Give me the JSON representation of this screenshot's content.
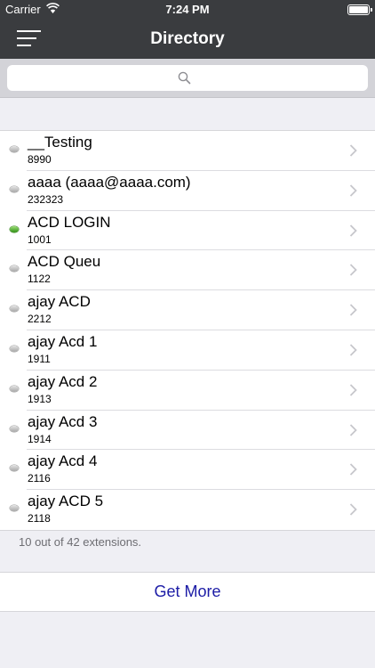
{
  "status_bar": {
    "carrier": "Carrier",
    "time": "7:24 PM"
  },
  "nav": {
    "title": "Directory",
    "menu_icon": "hamburger-icon"
  },
  "search": {
    "placeholder": "",
    "icon": "search-icon"
  },
  "contacts": [
    {
      "name": "__Testing",
      "ext": "8990",
      "status": "offline"
    },
    {
      "name": "aaaa (aaaa@aaaa.com)",
      "ext": "232323",
      "status": "offline"
    },
    {
      "name": "ACD LOGIN",
      "ext": "1001",
      "status": "online"
    },
    {
      "name": "ACD Queu",
      "ext": "1122",
      "status": "offline"
    },
    {
      "name": "ajay ACD",
      "ext": "2212",
      "status": "offline"
    },
    {
      "name": "ajay Acd 1",
      "ext": "1911",
      "status": "offline"
    },
    {
      "name": "ajay Acd 2",
      "ext": "1913",
      "status": "offline"
    },
    {
      "name": "ajay Acd 3",
      "ext": "1914",
      "status": "offline"
    },
    {
      "name": "ajay Acd 4",
      "ext": "2116",
      "status": "offline"
    },
    {
      "name": "ajay ACD 5",
      "ext": "2118",
      "status": "offline"
    }
  ],
  "footer": {
    "count_text": "10 out of 42 extensions.",
    "get_more_label": "Get More"
  },
  "colors": {
    "bar": "#3a3c3f",
    "online": "#3aa01a",
    "offline": "#b0b0b0",
    "link": "#1c1ca6"
  }
}
